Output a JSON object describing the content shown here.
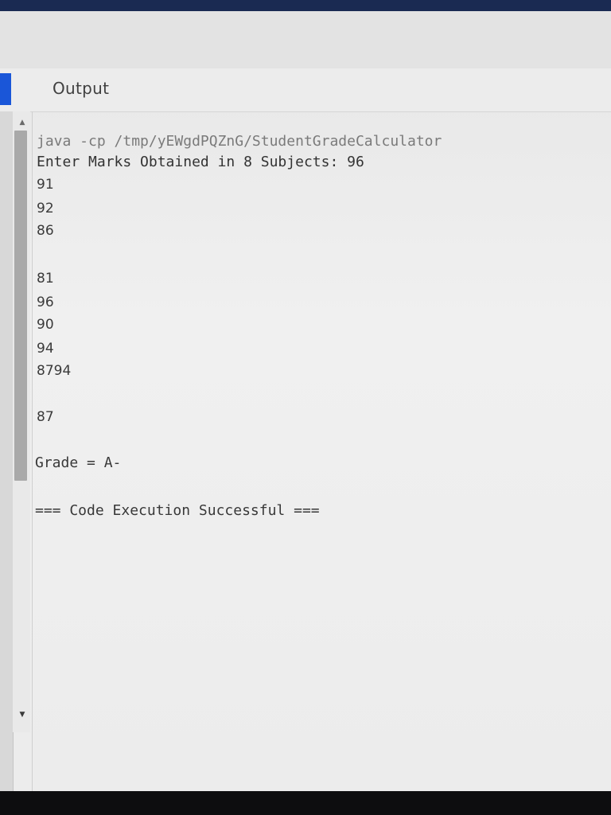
{
  "panel": {
    "title": "Output"
  },
  "console": {
    "command": "java -cp /tmp/yEWgdPQZnG/StudentGradeCalculator",
    "prompt": "Enter Marks Obtained in 8 Subjects: 96",
    "inputs": [
      "91",
      "92",
      "86",
      "81",
      "96",
      "90",
      "94",
      "8794",
      "87"
    ],
    "grade_line": "Grade = A-",
    "status_line": "=== Code Execution Successful ==="
  },
  "colors": {
    "accent": "#1a56d8",
    "background": "#ececec",
    "text": "#333333"
  },
  "icons": {
    "scroll_up": "scroll-up-arrow-icon",
    "scroll_down": "scroll-down-arrow-icon"
  }
}
